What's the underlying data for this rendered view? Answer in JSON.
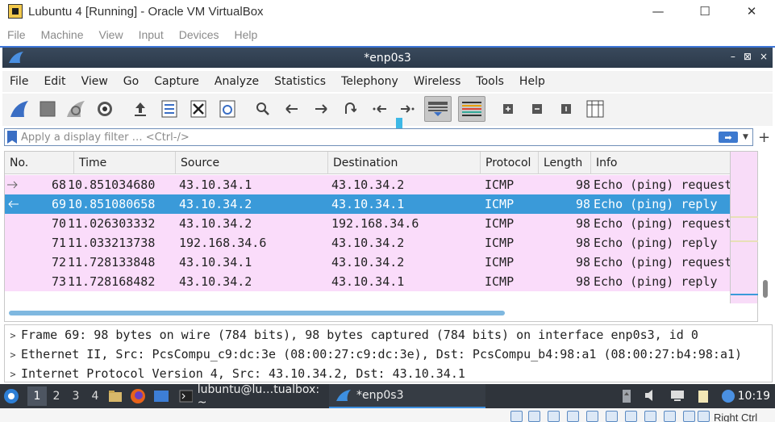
{
  "host": {
    "title": "Lubuntu 4 [Running] - Oracle VM VirtualBox",
    "menu": [
      "File",
      "Machine",
      "View",
      "Input",
      "Devices",
      "Help"
    ],
    "controls": [
      "—",
      "☐",
      "✕"
    ],
    "status_key": "Right Ctrl"
  },
  "wireshark": {
    "title": "*enp0s3",
    "title_controls": [
      "–",
      "⊠",
      "×"
    ],
    "menu": [
      "File",
      "Edit",
      "View",
      "Go",
      "Capture",
      "Analyze",
      "Statistics",
      "Telephony",
      "Wireless",
      "Tools",
      "Help"
    ],
    "filter": {
      "placeholder": "Apply a display filter … <Ctrl-/>"
    },
    "columns": [
      "No.",
      "Time",
      "Source",
      "Destination",
      "Protocol",
      "Length",
      "Info"
    ],
    "packets": [
      {
        "no": "68",
        "time": "10.851034680",
        "src": "43.10.34.1",
        "dst": "43.10.34.2",
        "proto": "ICMP",
        "len": "98",
        "info": "Echo (ping) request"
      },
      {
        "no": "69",
        "time": "10.851080658",
        "src": "43.10.34.2",
        "dst": "43.10.34.1",
        "proto": "ICMP",
        "len": "98",
        "info": "Echo (ping) reply"
      },
      {
        "no": "70",
        "time": "11.026303332",
        "src": "43.10.34.2",
        "dst": "192.168.34.6",
        "proto": "ICMP",
        "len": "98",
        "info": "Echo (ping) request"
      },
      {
        "no": "71",
        "time": "11.033213738",
        "src": "192.168.34.6",
        "dst": "43.10.34.2",
        "proto": "ICMP",
        "len": "98",
        "info": "Echo (ping) reply"
      },
      {
        "no": "72",
        "time": "11.728133848",
        "src": "43.10.34.1",
        "dst": "43.10.34.2",
        "proto": "ICMP",
        "len": "98",
        "info": "Echo (ping) request"
      },
      {
        "no": "73",
        "time": "11.728168482",
        "src": "43.10.34.2",
        "dst": "43.10.34.1",
        "proto": "ICMP",
        "len": "98",
        "info": "Echo (ping) reply"
      }
    ],
    "selected_packet": "69",
    "details": [
      "Frame 69: 98 bytes on wire (784 bits), 98 bytes captured (784 bits) on interface enp0s3, id 0",
      "Ethernet II, Src: PcsCompu_c9:dc:3e (08:00:27:c9:dc:3e), Dst: PcsCompu_b4:98:a1 (08:00:27:b4:98:a1)",
      "Internet Protocol Version 4, Src: 43.10.34.2, Dst: 43.10.34.1"
    ]
  },
  "taskbar": {
    "workspaces": [
      "1",
      "2",
      "3",
      "4"
    ],
    "active_workspace": "1",
    "terminal_label": "lubuntu@lu…tualbox: ~",
    "wireshark_label": "*enp0s3",
    "clock": "10:19"
  },
  "colors": {
    "row_bg": "#fadcfa",
    "row_selected": "#3a9ad9",
    "title_bar": "#2c3a4a",
    "taskbar": "#2f343b"
  }
}
